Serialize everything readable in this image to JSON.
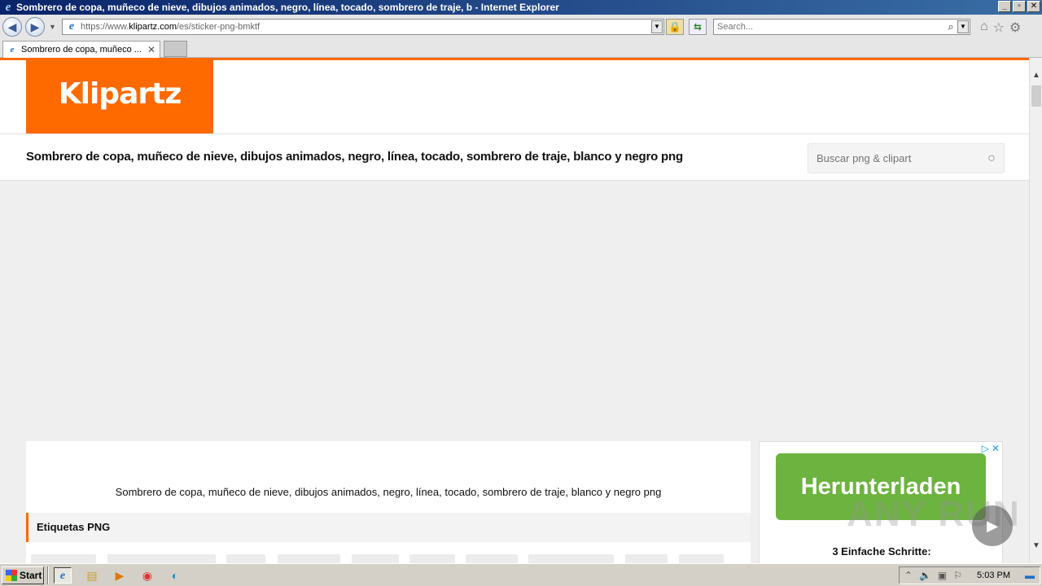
{
  "window": {
    "title": "Sombrero de copa, muñeco de nieve, dibujos animados, negro, línea, tocado, sombrero de traje, b - Internet Explorer",
    "minimize": "_",
    "restore": "▫",
    "close": "✕"
  },
  "nav": {
    "back": "◀",
    "forward": "▶",
    "url_prefix": "https://www.",
    "url_host": "klipartz.com",
    "url_path": "/es/sticker-png-bmktf",
    "search_placeholder": "Search...",
    "icons": [
      "home-icon",
      "favorites-star-icon",
      "tools-gear-icon"
    ]
  },
  "tabs": [
    {
      "label": "Sombrero de copa, muñeco ...",
      "close": "✕"
    }
  ],
  "site": {
    "logo_text": "Klipartz",
    "page_title": "Sombrero de copa, muñeco de nieve, dibujos animados, negro, línea, tocado, sombrero de traje, blanco y negro png",
    "search_placeholder": "Buscar png & clipart",
    "caption": "Sombrero de copa, muñeco de nieve, dibujos animados, negro, línea, tocado, sombrero de traje, blanco y negro png",
    "tags_heading": "Etiquetas PNG",
    "accent_color": "#ff6a00"
  },
  "ad": {
    "button_text": "Herunterladen",
    "subtitle": "3 Einfache Schritte:",
    "button_color": "#6cb33f"
  },
  "watermark": {
    "text": "ANY RUN"
  },
  "taskbar": {
    "start_label": "Start",
    "clock": "5:03 PM",
    "icons": [
      "internet-explorer-icon",
      "file-explorer-icon",
      "media-player-icon",
      "chrome-icon",
      "edge-icon"
    ]
  }
}
